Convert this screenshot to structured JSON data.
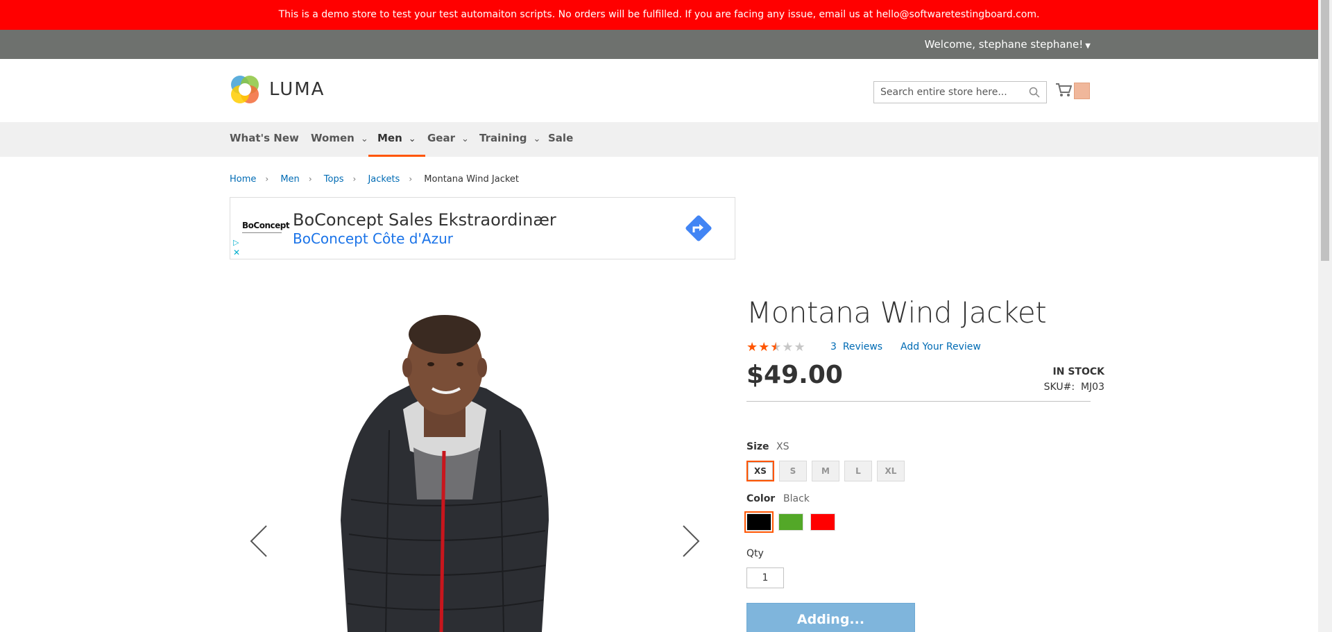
{
  "demo_notice": "This is a demo store to test your test automaiton scripts. No orders will be fulfilled. If you are facing any issue, email us at hello@softwaretestingboard.com.",
  "header": {
    "welcome": "Welcome, stephane stephane!",
    "logo_text": "LUMA",
    "search_placeholder": "Search entire store here..."
  },
  "nav": {
    "items": [
      {
        "label": "What's New"
      },
      {
        "label": "Women"
      },
      {
        "label": "Men"
      },
      {
        "label": "Gear"
      },
      {
        "label": "Training"
      },
      {
        "label": "Sale"
      }
    ],
    "active": "Men"
  },
  "breadcrumb": [
    "Home",
    "Men",
    "Tops",
    "Jackets",
    "Montana Wind Jacket"
  ],
  "ad": {
    "brand": "BoConcept",
    "title": "BoConcept Sales Ekstraordinær",
    "subtitle": "BoConcept Côte d'Azur"
  },
  "product": {
    "title": "Montana Wind Jacket",
    "rating_stars": 2.5,
    "reviews_count": "3",
    "reviews_label": "Reviews",
    "add_review": "Add Your Review",
    "price": "$49.00",
    "stock": "IN STOCK",
    "sku_label": "SKU#:",
    "sku": "MJ03",
    "size_label": "Size",
    "size_selected": "XS",
    "sizes": [
      "XS",
      "S",
      "M",
      "L",
      "XL"
    ],
    "color_label": "Color",
    "color_selected": "Black",
    "colors": [
      {
        "name": "Black",
        "hex": "#000000"
      },
      {
        "name": "Green",
        "hex": "#53a828"
      },
      {
        "name": "Red",
        "hex": "#ff0000"
      }
    ],
    "qty_label": "Qty",
    "qty": "1",
    "add_button": "Adding..."
  },
  "colors": {
    "demo_bar": "#ff0000",
    "accent": "#ff5501",
    "link": "#006bb4"
  }
}
